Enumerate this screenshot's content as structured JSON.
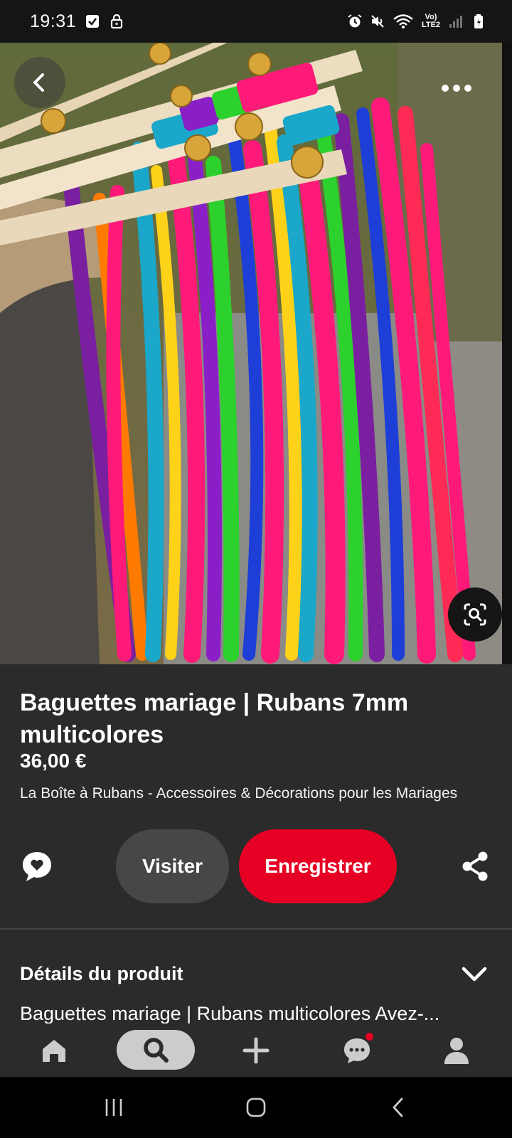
{
  "status_bar": {
    "time": "19:31",
    "network_label": "Vo) LTE2",
    "icons": [
      "check-notification-icon",
      "lock-icon",
      "alarm-icon",
      "mute-icon",
      "wifi-icon",
      "signal-icon",
      "battery-icon"
    ]
  },
  "hero": {
    "image_name": "colorful-ribbon-wands-photo",
    "more_options": "more-options",
    "visual_search": "visual-search"
  },
  "product": {
    "title": "Baguettes mariage | Rubans 7mm multicolores",
    "price": "36,00 €",
    "merchant": "La Boîte à Rubans - Accessoires & Décorations pour les Mariages"
  },
  "actions": {
    "visit_label": "Visiter",
    "save_label": "Enregistrer"
  },
  "details": {
    "header": "Détails du produit",
    "preview": "Baguettes mariage | Rubans multicolores Avez-..."
  },
  "bottom_nav": {
    "items": [
      "home",
      "search",
      "create",
      "messages",
      "profile"
    ],
    "active": "search"
  },
  "colors": {
    "accent": "#e60023",
    "panel": "#2b2b2b",
    "secondary_button": "#474747"
  }
}
